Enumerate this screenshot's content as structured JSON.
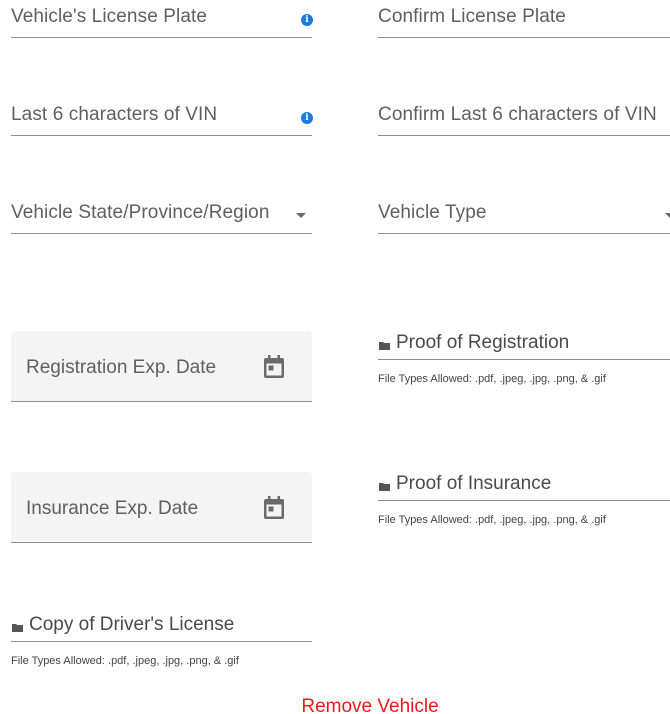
{
  "fields": {
    "license_plate": {
      "label": "Vehicle's License Plate",
      "icon": "info-icon"
    },
    "confirm_license_plate": {
      "label": "Confirm License Plate"
    },
    "vin_last6": {
      "label": "Last 6 characters of VIN",
      "icon": "info-icon"
    },
    "confirm_vin_last6": {
      "label": "Confirm Last 6 characters of VIN"
    },
    "vehicle_state": {
      "label": "Vehicle State/Province/Region",
      "icon": "chevron-down-icon"
    },
    "vehicle_type": {
      "label": "Vehicle Type",
      "icon": "chevron-down-icon"
    },
    "registration_exp": {
      "label": "Registration Exp. Date",
      "icon": "calendar-icon"
    },
    "insurance_exp": {
      "label": "Insurance Exp. Date",
      "icon": "calendar-icon"
    }
  },
  "uploads": {
    "proof_of_registration": {
      "label": "Proof of Registration",
      "hint": "File Types Allowed: .pdf, .jpeg, .jpg, .png, & .gif"
    },
    "proof_of_insurance": {
      "label": "Proof of Insurance",
      "hint": "File Types Allowed: .pdf, .jpeg, .jpg, .png, & .gif"
    },
    "drivers_license": {
      "label": "Copy of Driver's License",
      "hint": "File Types Allowed: .pdf, .jpeg, .jpg, .png, & .gif"
    }
  },
  "actions": {
    "remove_vehicle": "Remove Vehicle"
  },
  "colors": {
    "info_icon": "#1e78e6",
    "remove_action": "#f21818",
    "date_field_bg": "#f4f4f4"
  }
}
